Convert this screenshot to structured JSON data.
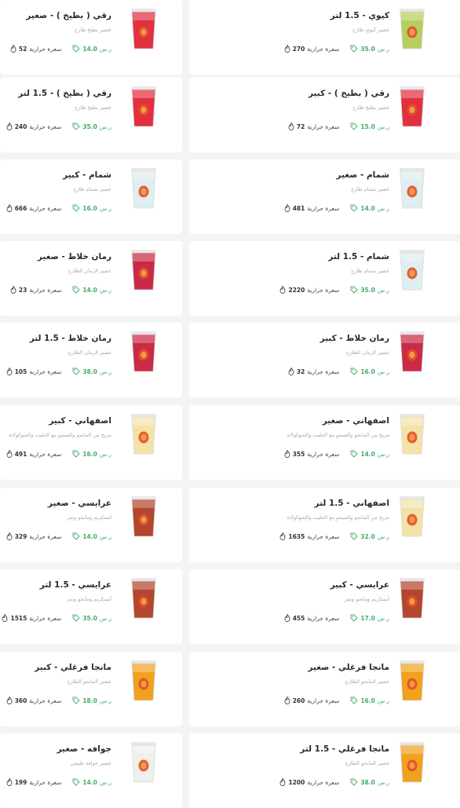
{
  "currency": "ر.س",
  "cal_unit": "سعرة حرارية",
  "rows": [
    {
      "right": {
        "title": "كيوي - 1.5 لتر",
        "desc": "عصير كيوي طازج",
        "price": "35.0",
        "cal": "270",
        "color": "#b5cf5e"
      },
      "left": {
        "title": "رقي ( بطيخ ) - صغير",
        "desc": "عصير بطيخ طازج",
        "price": "14.0",
        "cal": "52",
        "color": "#e2303f"
      }
    },
    {
      "right": {
        "title": "رقي ( بطيخ ) - كبير",
        "desc": "عصير بطيخ طازج",
        "price": "15.0",
        "cal": "72",
        "color": "#e2303f"
      },
      "left": {
        "title": "رقي ( بطيخ ) - 1.5 لتر",
        "desc": "عصير بطيخ طازج",
        "price": "35.0",
        "cal": "240",
        "color": "#e2303f"
      }
    },
    {
      "right": {
        "title": "شمام - صغير",
        "desc": "عصير شمام طازج",
        "price": "14.0",
        "cal": "481",
        "color": "#dfeef0"
      },
      "left": {
        "title": "شمام - كبير",
        "desc": "عصير شمام طازج",
        "price": "16.0",
        "cal": "666",
        "color": "#dfeef0"
      }
    },
    {
      "right": {
        "title": "شمام - 1.5 لتر",
        "desc": "عصير شمام طازج",
        "price": "35.0",
        "cal": "2220",
        "color": "#dfeef0"
      },
      "left": {
        "title": "رمان خلاط - صغير",
        "desc": "عصير الرمان الطازج",
        "price": "14.0",
        "cal": "23",
        "color": "#c92a45"
      }
    },
    {
      "right": {
        "title": "رمان خلاط - كبير",
        "desc": "عصير الرمان الطازج",
        "price": "16.0",
        "cal": "32",
        "color": "#c92a45"
      },
      "left": {
        "title": "رمان خلاط - 1.5 لتر",
        "desc": "عصير الرمان الطازج",
        "price": "38.0",
        "cal": "105",
        "color": "#c92a45"
      }
    },
    {
      "right": {
        "title": "اصفهاني - صغير",
        "desc": "مزيج من المانجو والفيمتو مع الحليب والشوكولاتة",
        "price": "14.0",
        "cal": "355",
        "color": "#f3e3a9"
      },
      "left": {
        "title": "اصفهاني - كبير",
        "desc": "مزيج من المانجو والفيمتو مع الحليب والشوكولاتة",
        "price": "16.0",
        "cal": "491",
        "color": "#f3e3a9"
      }
    },
    {
      "right": {
        "title": "اصفهاني - 1.5 لتر",
        "desc": "مزيج من المانجو والفيمتو مع الحليب والشوكولاتة",
        "price": "32.0",
        "cal": "1635",
        "color": "#f3e3a9"
      },
      "left": {
        "title": "عرايسي - صغير",
        "desc": "أيسكريم ومانجو وتمر",
        "price": "14.0",
        "cal": "329",
        "color": "#b3462e"
      }
    },
    {
      "right": {
        "title": "عرايسي - كبير",
        "desc": "أيسكريم ومانجو وتمر",
        "price": "17.0",
        "cal": "455",
        "color": "#b3462e"
      },
      "left": {
        "title": "عرايسي - 1.5 لتر",
        "desc": "أيسكريم ومانجو وتمر",
        "price": "35.0",
        "cal": "1515",
        "color": "#b3462e"
      }
    },
    {
      "right": {
        "title": "مانجا فرغلي - صغير",
        "desc": "عصير المانجو الطازج",
        "price": "16.0",
        "cal": "260",
        "color": "#f0a21e"
      },
      "left": {
        "title": "مانجا فرغلي - كبير",
        "desc": "عصير المانجو الطازج",
        "price": "18.0",
        "cal": "360",
        "color": "#f0a21e"
      }
    },
    {
      "right": {
        "title": "مانجا فرغلي - 1.5 لتر",
        "desc": "عصير المانجو الطازج",
        "price": "38.0",
        "cal": "1200",
        "color": "#f0a21e"
      },
      "left": {
        "title": "جوافه - صغير",
        "desc": "عصير جوافة طبيعي",
        "price": "14.0",
        "cal": "199",
        "color": "#eef0ea"
      }
    }
  ]
}
